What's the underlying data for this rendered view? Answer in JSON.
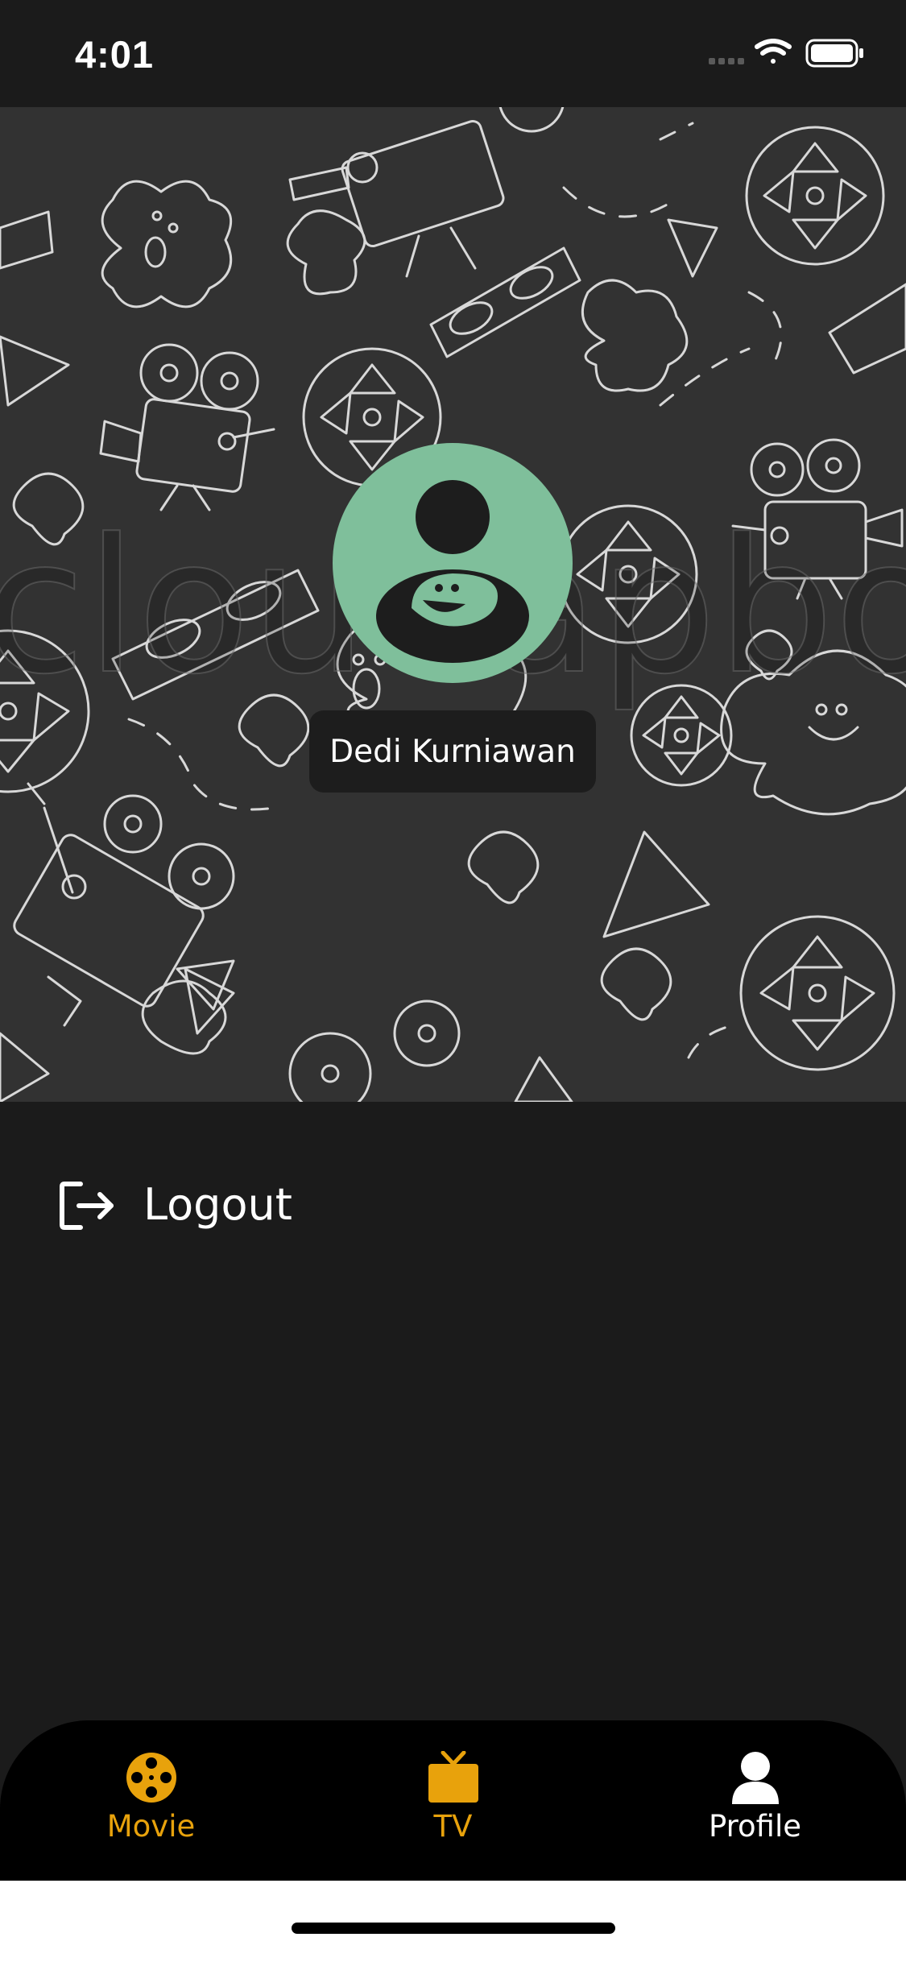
{
  "status_bar": {
    "time": "4:01",
    "icons": [
      "cellular-icon",
      "wifi-icon",
      "battery-icon"
    ]
  },
  "profile": {
    "name": "Dedi Kurniawan",
    "avatar_color": "#7fbf9b",
    "header_background": "#323232",
    "watermark_text": "cloudapbox"
  },
  "menu": {
    "items": [
      {
        "label": "Logout",
        "icon": "logout-icon"
      }
    ]
  },
  "tabbar": {
    "active_color": "#ffffff",
    "accent_color": "#e8a20c",
    "tabs": [
      {
        "label": "Movie",
        "icon": "film-reel-icon",
        "selected": false
      },
      {
        "label": "TV",
        "icon": "tv-icon",
        "selected": false
      },
      {
        "label": "Profile",
        "icon": "person-icon",
        "selected": true
      }
    ]
  }
}
